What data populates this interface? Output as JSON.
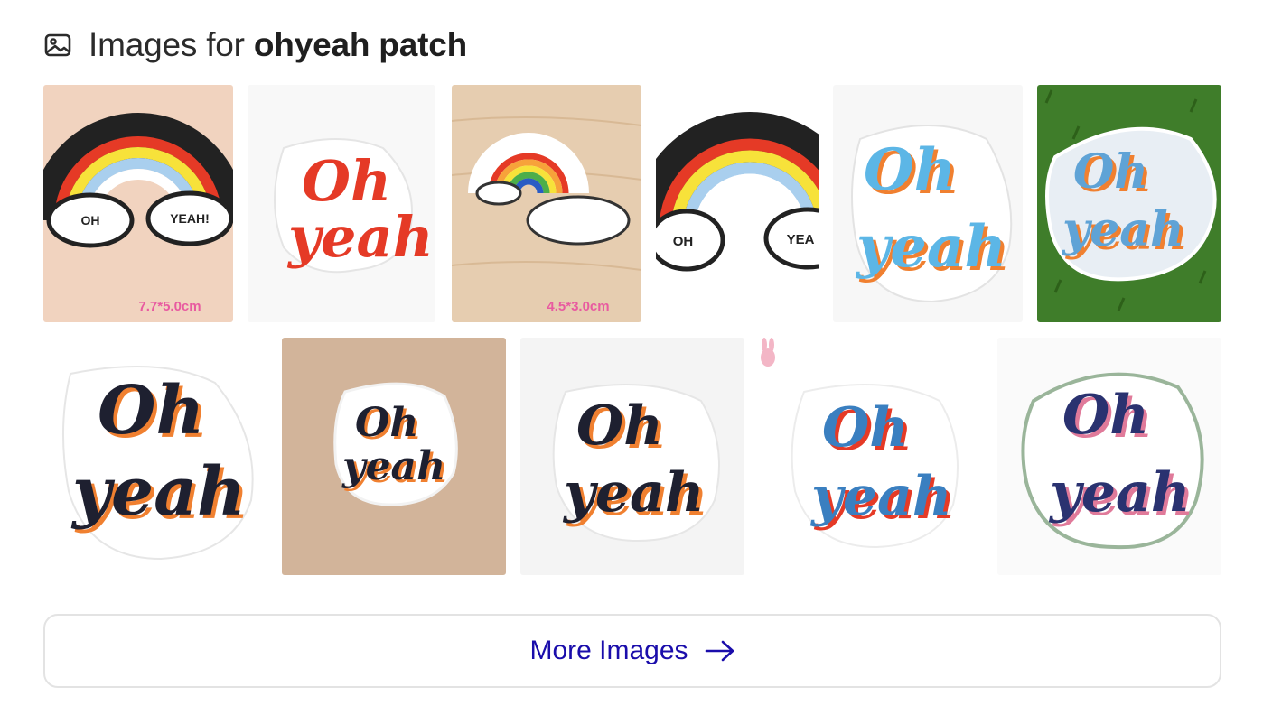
{
  "header": {
    "prefix": "Images for",
    "query": "ohyeah patch"
  },
  "thumbs_row1": [
    {
      "name": "rainbow-cloud-patch-image",
      "size_label": "7.7*5.0cm",
      "cloud_left": "OH",
      "cloud_right": "YEAH!"
    },
    {
      "name": "oh-yeah-red-patch-image",
      "line1": "Oh",
      "line2": "yeah"
    },
    {
      "name": "rainbow-cloud-wood-patch-image",
      "size_label": "4.5*3.0cm"
    },
    {
      "name": "rainbow-cloud-cropped-patch-image",
      "cloud_left": "OH",
      "cloud_right": "YEA"
    },
    {
      "name": "oh-yeah-blue-patch-image",
      "line1": "Oh",
      "line2": "yeah"
    },
    {
      "name": "oh-yeah-grass-patch-image",
      "line1": "Oh",
      "line2": "yeah"
    }
  ],
  "thumbs_row2": [
    {
      "name": "oh-yeah-large-patch-image",
      "line1": "Oh",
      "line2": "yeah"
    },
    {
      "name": "oh-yeah-tan-background-patch-image",
      "line1": "Oh",
      "line2": "yeah"
    },
    {
      "name": "oh-yeah-white-background-patch-image",
      "line1": "Oh",
      "line2": "yeah"
    },
    {
      "name": "oh-yeah-blue-shadow-patch-image",
      "line1": "Oh",
      "line2": "yeah"
    },
    {
      "name": "oh-yeah-navy-patch-image",
      "line1": "Oh",
      "line2": "yeah"
    }
  ],
  "more_button": {
    "label": "More Images"
  },
  "icons": {
    "header": "image-icon",
    "more": "arrow-right-icon"
  },
  "colors": {
    "link": "#1a0dab",
    "border": "#e3e3e3",
    "text": "#222222"
  }
}
